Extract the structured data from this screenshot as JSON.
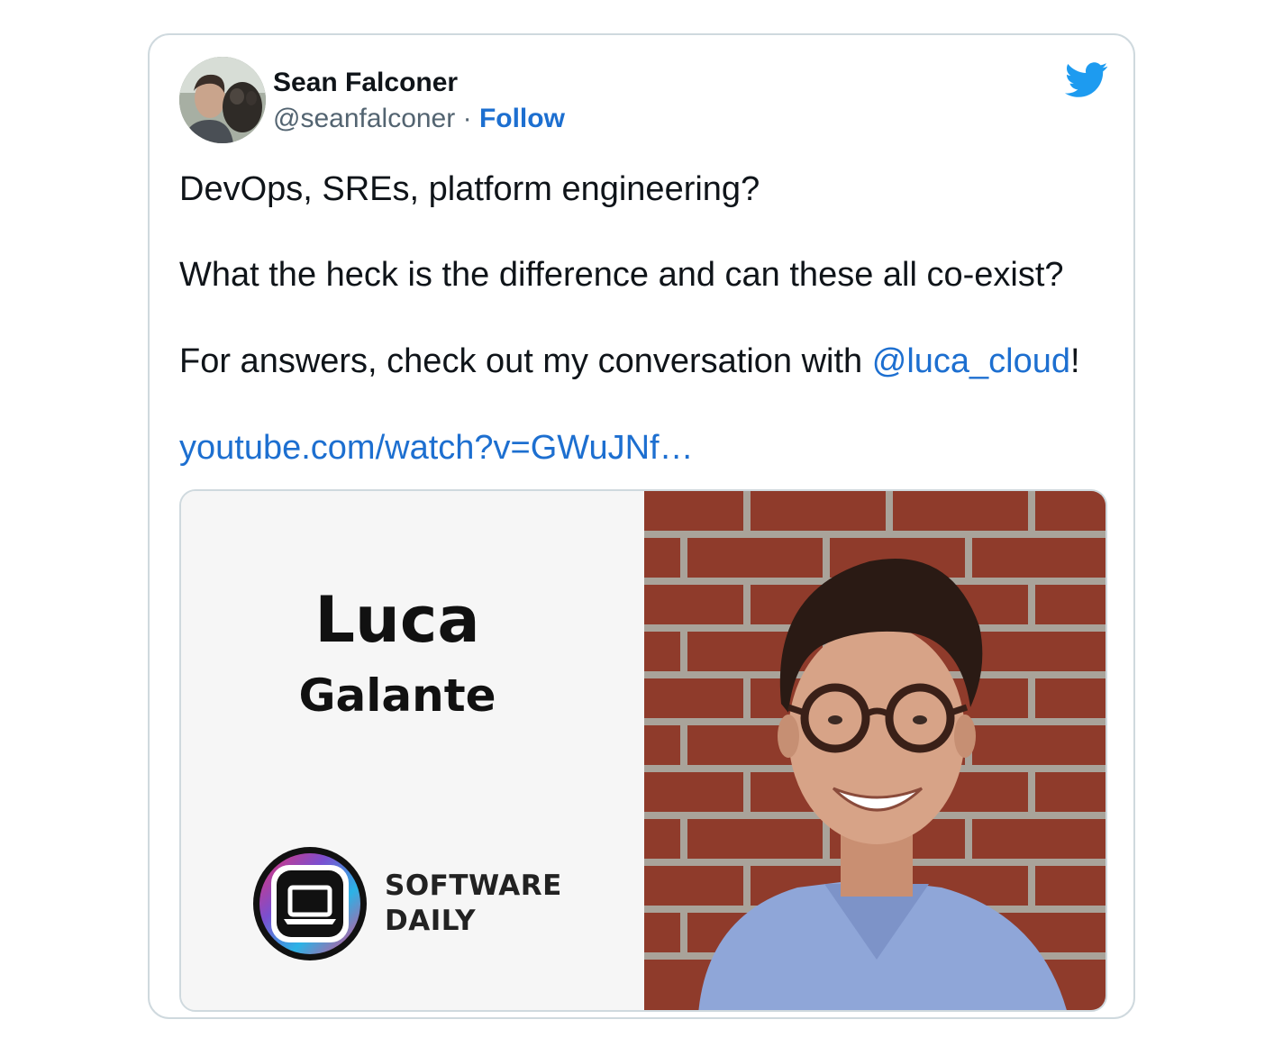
{
  "tweet": {
    "author_name": "Sean Falconer",
    "handle": "@seanfalconer",
    "separator": "·",
    "follow_label": "Follow",
    "line1": "DevOps, SREs, platform engineering?",
    "line2": "What the heck is the difference and can these all co-exist?",
    "line3_prefix": "For answers, check out my conversation with ",
    "mention": "@luca_cloud",
    "line3_suffix": "!",
    "url": "youtube.com/watch?v=GWuJNf…"
  },
  "media": {
    "guest_first_name": "Luca",
    "guest_last_name": "Galante",
    "brand_line1": "SOFTWARE",
    "brand_line2": "DAILY"
  },
  "colors": {
    "link": "#1d6fd0",
    "twitter_blue": "#1d9bf0",
    "border": "#cfd9de"
  },
  "icons": [
    "twitter-bird-icon",
    "software-daily-laptop-icon"
  ]
}
